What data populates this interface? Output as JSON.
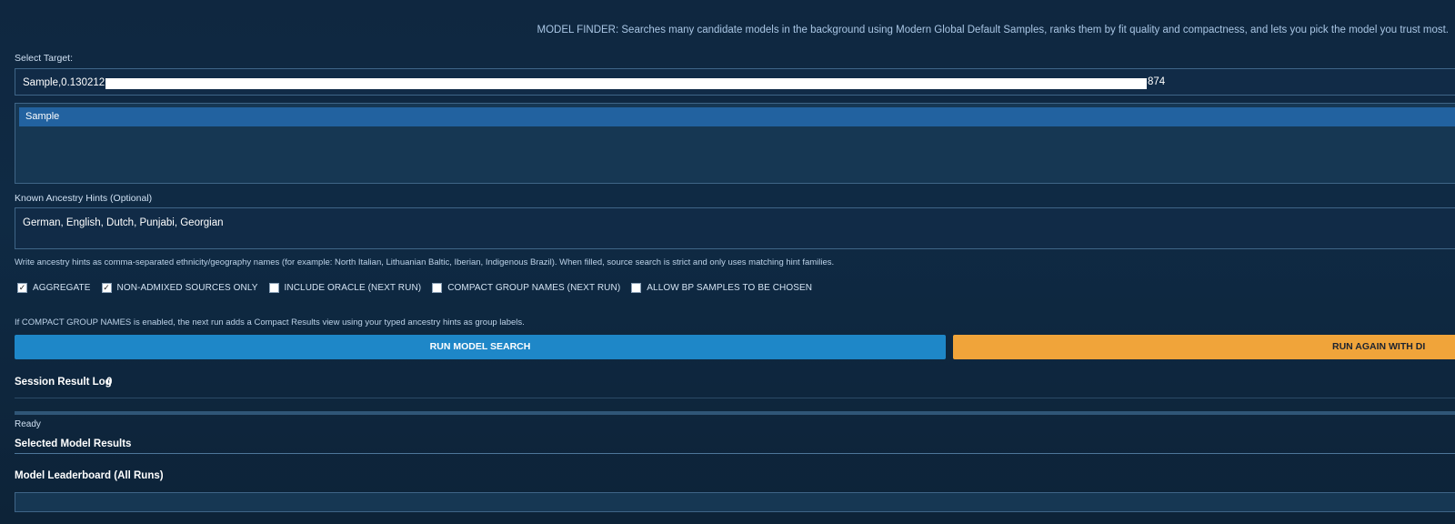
{
  "banner": "MODEL FINDER: Searches many candidate models in the background using Modern Global Default Samples, ranks them by fit quality and compactness, and lets you pick the model you trust most.",
  "target": {
    "label": "Select Target:",
    "value_prefix": "Sample,0.130212,",
    "value_suffix": "874",
    "list_items": [
      "Sample"
    ]
  },
  "hints": {
    "label": "Known Ancestry Hints (Optional)",
    "value": "German, English, Dutch, Punjabi, Georgian",
    "help": "Write ancestry hints as comma-separated ethnicity/geography names (for example: North Italian, Lithuanian Baltic, Iberian, Indigenous Brazil). When filled, source search is strict and only uses matching hint families."
  },
  "options": [
    {
      "label": "AGGREGATE",
      "checked": true
    },
    {
      "label": "NON-ADMIXED SOURCES ONLY",
      "checked": true
    },
    {
      "label": "INCLUDE ORACLE (NEXT RUN)",
      "checked": false
    },
    {
      "label": "COMPACT GROUP NAMES (NEXT RUN)",
      "checked": false
    },
    {
      "label": "ALLOW BP SAMPLES TO BE CHOSEN",
      "checked": false
    }
  ],
  "compact_note": "If COMPACT GROUP NAMES is enabled, the next run adds a Compact Results view using your typed ancestry hints as group labels.",
  "buttons": {
    "run": "RUN MODEL SEARCH",
    "again": "RUN AGAIN WITH DI"
  },
  "session": {
    "title": "Session Result Log",
    "count": "0",
    "status": "Ready"
  },
  "sections": {
    "selected": "Selected Model Results",
    "leaderboard": "Model Leaderboard (All Runs)"
  },
  "colors": {
    "background": "#0f2740",
    "primary_button": "#1e87c8",
    "secondary_button": "#f0a43a",
    "selected_item": "#2262a0"
  }
}
